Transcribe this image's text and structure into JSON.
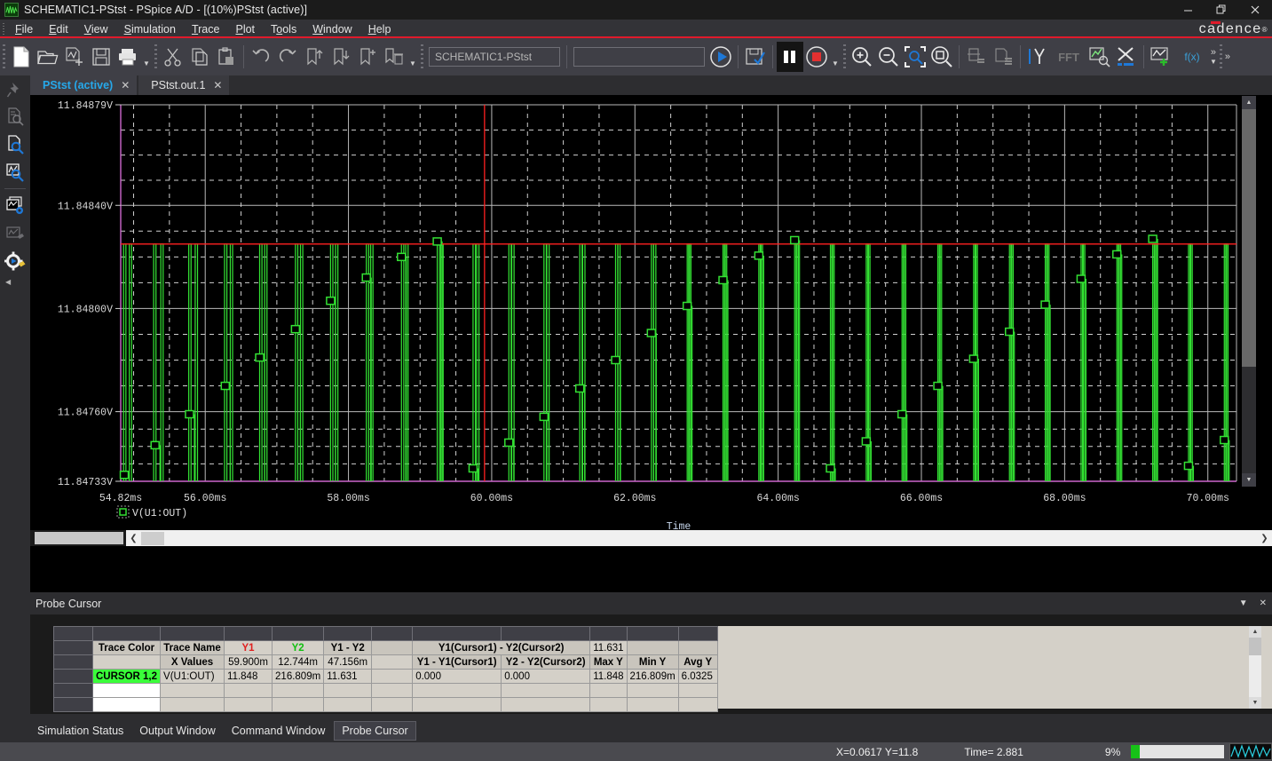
{
  "window": {
    "title": "SCHEMATIC1-PStst - PSpice A/D  - [(10%)PStst (active)]",
    "app_icon": "pspice-waveform-icon",
    "minimize": "—",
    "maximize": "❐",
    "close": "✕",
    "brand": "cadence",
    "brand_reg": "®"
  },
  "menu": {
    "items": [
      {
        "label": "File",
        "accel": "F"
      },
      {
        "label": "Edit",
        "accel": "E"
      },
      {
        "label": "View",
        "accel": "V"
      },
      {
        "label": "Simulation",
        "accel": "S"
      },
      {
        "label": "Trace",
        "accel": "T"
      },
      {
        "label": "Plot",
        "accel": "P"
      },
      {
        "label": "Tools",
        "accel": "o"
      },
      {
        "label": "Window",
        "accel": "W"
      },
      {
        "label": "Help",
        "accel": "H"
      }
    ]
  },
  "toolbar": {
    "group1": [
      "new-file-icon",
      "open-folder-icon",
      "open-simulation-icon",
      "save-icon",
      "print-icon"
    ],
    "group2": [
      "cut-icon",
      "copy-icon",
      "paste-icon"
    ],
    "group3": [
      "undo-icon",
      "redo-icon",
      "bookmark-up-icon",
      "bookmark-down-icon",
      "bookmark-add-icon",
      "bookmark-delete-icon"
    ],
    "profile_field": "SCHEMATIC1-PStst",
    "profile_placeholder": "SCHEMATIC1-PStst",
    "command_field": "",
    "command_placeholder": "",
    "group4": [
      "run-simulation-icon",
      "save-simulation-icon",
      "pause-simulation-icon",
      "stop-simulation-icon"
    ],
    "group5": [
      "zoom-in-icon",
      "zoom-out-icon",
      "zoom-area-icon",
      "zoom-fit-icon"
    ],
    "group6": [
      "print-preview-icon",
      "page-setup-icon"
    ],
    "group7": [
      "cursor-icon",
      "fft-icon",
      "performance-analysis-icon",
      "axis-settings-icon",
      "add-trace-icon",
      "eval-goal-icon"
    ],
    "fft_label": "FFT",
    "fx_label": "f(x)",
    "overflow": "»"
  },
  "sidebar": {
    "items": [
      {
        "name": "pin-icon",
        "label": "Pin"
      },
      {
        "name": "file-search-icon",
        "label": "Find in output file"
      },
      {
        "name": "file-search-active-icon",
        "label": "Output file search"
      },
      {
        "name": "waveform-search-icon",
        "label": "Waveform search"
      },
      {
        "name": "window-config-icon",
        "label": "Window configuration"
      },
      {
        "name": "waveform-edit-icon",
        "label": "Edit waveform"
      },
      {
        "name": "simulation-settings-icon",
        "label": "Simulation settings"
      }
    ],
    "collapse": "◀"
  },
  "tabs": [
    {
      "label": "PStst (active)",
      "active": true,
      "close": "✕"
    },
    {
      "label": "PStst.out.1",
      "active": false,
      "close": "✕"
    }
  ],
  "chart_data": {
    "type": "line",
    "title": "",
    "xlabel": "Time",
    "ylabel": "",
    "trace_legend": "V(U1:OUT)",
    "legend_marker": "square-marker",
    "grid": true,
    "xlim": [
      54.82,
      70.4
    ],
    "ylim": [
      11.84733,
      11.84879
    ],
    "xticks": [
      "54.82ms",
      "56.00ms",
      "58.00ms",
      "60.00ms",
      "62.00ms",
      "64.00ms",
      "66.00ms",
      "68.00ms",
      "70.00ms"
    ],
    "xtick_values": [
      54.82,
      56.0,
      58.0,
      60.0,
      62.0,
      64.0,
      66.0,
      68.0,
      70.0
    ],
    "yticks": [
      "11.84879V",
      "11.84840V",
      "11.84800V",
      "11.84760V",
      "11.84733V"
    ],
    "ytick_values": [
      11.84879,
      11.8484,
      11.848,
      11.8476,
      11.84733
    ],
    "trace_color": "#33e033",
    "cursor1_color": "#ff2020",
    "cursor2_color": "#cc66cc",
    "cursor1_x": 59.9,
    "cursor1_y": 11.84825,
    "cursor2_x": 54.82,
    "cursor2_y": 11.84733,
    "series": [
      {
        "name": "V(U1:OUT)",
        "description": "Narrow high-frequency voltage spikes clipped at 11.84825V with a slowly drifting sampled envelope",
        "spike_top": 11.84825,
        "spike_bottom": 11.84733,
        "spike_times": [
          54.86,
          54.94,
          55.28,
          55.38,
          55.77,
          55.86,
          56.27,
          56.35,
          56.76,
          56.83,
          57.26,
          57.33,
          57.75,
          57.82,
          58.25,
          58.31,
          58.74,
          58.8,
          59.24,
          59.29,
          59.74,
          59.79,
          60.24,
          60.28,
          60.73,
          60.77,
          61.23,
          61.27,
          61.73,
          61.76,
          62.23,
          62.26,
          62.73,
          62.75,
          63.23,
          63.25,
          63.73,
          63.75,
          64.23,
          64.25,
          64.73,
          64.75,
          65.23,
          65.25,
          65.73,
          65.75,
          66.23,
          66.25,
          66.73,
          66.75,
          67.23,
          67.25,
          67.73,
          67.75,
          68.23,
          68.25,
          68.73,
          68.75,
          69.23,
          69.25,
          69.73,
          69.75,
          70.23,
          70.25
        ],
        "marker_points": [
          {
            "t": 54.87,
            "v": 11.847355
          },
          {
            "t": 55.3,
            "v": 11.84747
          },
          {
            "t": 55.78,
            "v": 11.84759
          },
          {
            "t": 56.28,
            "v": 11.8477
          },
          {
            "t": 56.76,
            "v": 11.84781
          },
          {
            "t": 57.26,
            "v": 11.84792
          },
          {
            "t": 57.75,
            "v": 11.84803
          },
          {
            "t": 58.25,
            "v": 11.84812
          },
          {
            "t": 58.74,
            "v": 11.8482
          },
          {
            "t": 59.24,
            "v": 11.84826
          },
          {
            "t": 59.74,
            "v": 11.84738
          },
          {
            "t": 60.24,
            "v": 11.84748
          },
          {
            "t": 60.73,
            "v": 11.84758
          },
          {
            "t": 61.23,
            "v": 11.84769
          },
          {
            "t": 61.73,
            "v": 11.8478
          },
          {
            "t": 62.23,
            "v": 11.847905
          },
          {
            "t": 62.73,
            "v": 11.84801
          },
          {
            "t": 63.23,
            "v": 11.84811
          },
          {
            "t": 63.73,
            "v": 11.848205
          },
          {
            "t": 64.23,
            "v": 11.848265
          },
          {
            "t": 64.73,
            "v": 11.84738
          },
          {
            "t": 65.23,
            "v": 11.847485
          },
          {
            "t": 65.73,
            "v": 11.84759
          },
          {
            "t": 66.23,
            "v": 11.8477
          },
          {
            "t": 66.73,
            "v": 11.847805
          },
          {
            "t": 67.23,
            "v": 11.84791
          },
          {
            "t": 67.73,
            "v": 11.848015
          },
          {
            "t": 68.23,
            "v": 11.848115
          },
          {
            "t": 68.73,
            "v": 11.84821
          },
          {
            "t": 69.23,
            "v": 11.84827
          },
          {
            "t": 69.73,
            "v": 11.84739
          },
          {
            "t": 70.23,
            "v": 11.84749
          }
        ]
      }
    ]
  },
  "probe_cursor": {
    "panel_title": "Probe Cursor",
    "minimize_icon": "chevron-down-icon",
    "close_icon": "close-icon",
    "headers": {
      "trace_color": "Trace Color",
      "trace_name": "Trace Name",
      "y1": "Y1",
      "y2": "Y2",
      "y1_minus_y2": "Y1 - Y2",
      "cursor_diff_label": "Y1(Cursor1) - Y2(Cursor2)",
      "cursor_diff_value": "11.631",
      "x_values": "X Values",
      "y1_delta": "Y1 - Y1(Cursor1)",
      "y2_delta": "Y2 - Y2(Cursor2)",
      "max_y": "Max Y",
      "min_y": "Min Y",
      "avg_y": "Avg Y"
    },
    "x_values_row": {
      "y1": "59.900m",
      "y2": "12.744m",
      "y1_minus_y2": "47.156m"
    },
    "rows": [
      {
        "cursor_label": "CURSOR 1,2",
        "trace_name": "V(U1:OUT)",
        "y1": "11.848",
        "y2": "216.809m",
        "y1_minus_y2": "11.631",
        "y1_delta": "0.000",
        "y2_delta": "0.000",
        "max_y": "11.848",
        "min_y": "216.809m",
        "avg_y": "6.0325"
      }
    ]
  },
  "bottom_tabs": [
    {
      "label": "Simulation Status",
      "active": false
    },
    {
      "label": "Output Window",
      "active": false
    },
    {
      "label": "Command Window",
      "active": false
    },
    {
      "label": "Probe Cursor",
      "active": true
    }
  ],
  "statusbar": {
    "coords": "X=0.0617  Y=11.8",
    "time": "Time= 2.881",
    "percent": "9%",
    "progress_value": 9,
    "mini_icon": "waveform-thumbnail-icon"
  }
}
